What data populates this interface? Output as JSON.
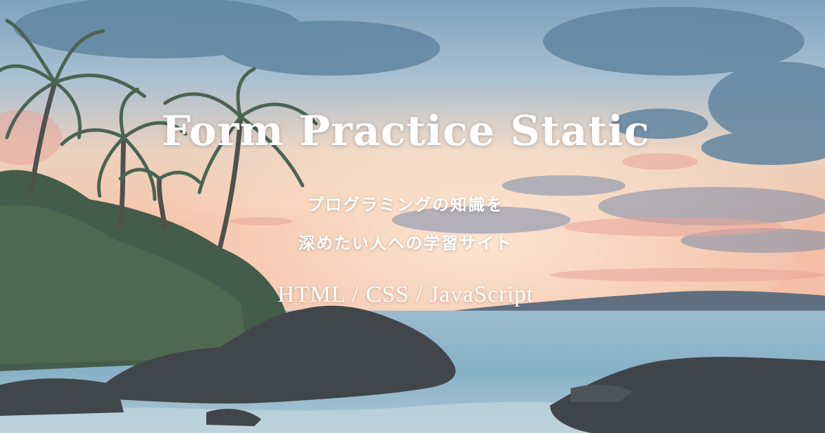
{
  "hero": {
    "title": "Form Practice Static",
    "subtitle_line1": "プログラミングの知識を",
    "subtitle_line2": "深めたい人への学習サイト",
    "tech_stack": "HTML / CSS / JavaScript"
  },
  "colors": {
    "text": "#ffffff",
    "sky_top": "#5f8fb0",
    "sunset": "#f2c4a0",
    "sea": "#7fa9c0",
    "foliage": "#2f4a36",
    "rocks": "#2b2f33"
  }
}
